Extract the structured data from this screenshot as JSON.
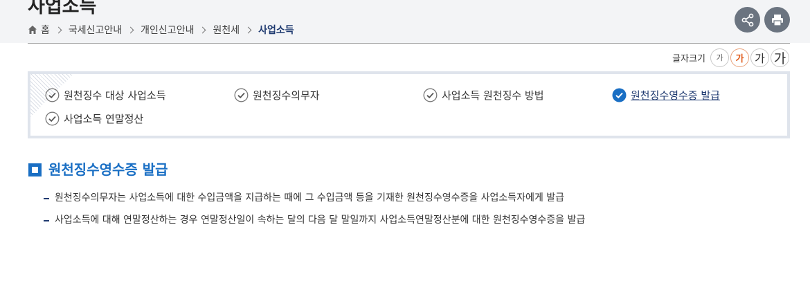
{
  "page": {
    "title": "사업소득"
  },
  "breadcrumb": {
    "items": [
      {
        "label": "홈",
        "icon": "home-icon"
      },
      {
        "label": "국세신고안내"
      },
      {
        "label": "개인신고안내"
      },
      {
        "label": "원천세"
      },
      {
        "label": "사업소득"
      }
    ]
  },
  "actions": {
    "share_icon": "share-icon",
    "print_icon": "print-icon"
  },
  "font_size": {
    "label": "글자크기",
    "options": [
      "가",
      "가",
      "가",
      "가"
    ],
    "selected_index": 1
  },
  "toc": {
    "items": [
      {
        "label": "원천징수 대상 사업소득",
        "active": false
      },
      {
        "label": "원천징수의무자",
        "active": false
      },
      {
        "label": "사업소득 원천징수 방법",
        "active": false
      },
      {
        "label": "원천징수영수증 발급",
        "active": true
      },
      {
        "label": "사업소득 연말정산",
        "active": false
      }
    ]
  },
  "section": {
    "title": "원천징수영수증 발급",
    "paragraphs": [
      "원천징수의무자는 사업소득에 대한 수입금액을 지급하는 때에 그 수입금액 등을 기재한 원천징수영수증을 사업소득자에게 발급",
      "사업소득에 대해 연말정산하는 경우 연말정산일이 속하는 달의 다음 달 말일까지 사업소득연말정산분에 대한 원천징수영수증을 발급"
    ]
  },
  "colors": {
    "accent": "#1a6fc4",
    "breadcrumb_current": "#1f3a70",
    "active_font_size": "#e05a1a",
    "action_button": "#6b7480"
  }
}
